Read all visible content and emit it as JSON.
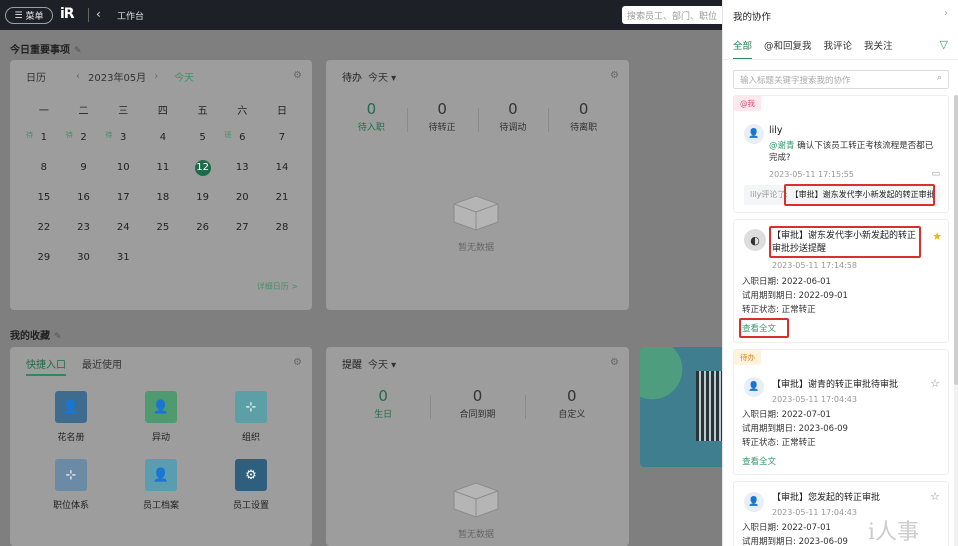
{
  "topbar": {
    "menu_label": "菜单",
    "logo_text": "iR",
    "breadcrumb": "工作台",
    "search_placeholder": "搜索员工、部门、职位"
  },
  "today": {
    "section_title": "今日重要事项",
    "calendar": {
      "title": "日历",
      "month": "2023年05月",
      "today_label": "今天",
      "weekdays": [
        "一",
        "二",
        "三",
        "四",
        "五",
        "六",
        "日"
      ],
      "weeks": [
        [
          {
            "d": "1",
            "m": "待"
          },
          {
            "d": "2",
            "m": "待"
          },
          {
            "d": "3",
            "m": "待"
          },
          {
            "d": "4",
            "m": ""
          },
          {
            "d": "5",
            "m": ""
          },
          {
            "d": "6",
            "m": "班"
          },
          {
            "d": "7",
            "m": ""
          }
        ],
        [
          {
            "d": "8",
            "m": ""
          },
          {
            "d": "9",
            "m": ""
          },
          {
            "d": "10",
            "m": ""
          },
          {
            "d": "11",
            "m": ""
          },
          {
            "d": "12",
            "m": "",
            "today": true
          },
          {
            "d": "13",
            "m": ""
          },
          {
            "d": "14",
            "m": ""
          }
        ],
        [
          {
            "d": "15",
            "m": ""
          },
          {
            "d": "16",
            "m": ""
          },
          {
            "d": "17",
            "m": ""
          },
          {
            "d": "18",
            "m": ""
          },
          {
            "d": "19",
            "m": ""
          },
          {
            "d": "20",
            "m": ""
          },
          {
            "d": "21",
            "m": ""
          }
        ],
        [
          {
            "d": "22",
            "m": ""
          },
          {
            "d": "23",
            "m": ""
          },
          {
            "d": "24",
            "m": ""
          },
          {
            "d": "25",
            "m": ""
          },
          {
            "d": "26",
            "m": ""
          },
          {
            "d": "27",
            "m": ""
          },
          {
            "d": "28",
            "m": ""
          }
        ],
        [
          {
            "d": "29",
            "m": ""
          },
          {
            "d": "30",
            "m": ""
          },
          {
            "d": "31",
            "m": ""
          },
          {
            "d": "",
            "m": ""
          },
          {
            "d": "",
            "m": ""
          },
          {
            "d": "",
            "m": ""
          },
          {
            "d": "",
            "m": ""
          }
        ]
      ],
      "detail_link": "详细日历 >"
    },
    "todo": {
      "title": "待办",
      "filter": "今天",
      "stats": [
        {
          "num": "0",
          "label": "待入职"
        },
        {
          "num": "0",
          "label": "待转正"
        },
        {
          "num": "0",
          "label": "待调动"
        },
        {
          "num": "0",
          "label": "待离职"
        }
      ],
      "empty_text": "暂无数据"
    }
  },
  "favorites": {
    "section_title": "我的收藏",
    "tabs": [
      "快捷入口",
      "最近使用"
    ],
    "shortcuts": [
      {
        "label": "花名册",
        "color": "#3e6c8f"
      },
      {
        "label": "异动",
        "color": "#4f9a6e"
      },
      {
        "label": "组织",
        "color": "#5c9fa6"
      },
      {
        "label": "职位体系",
        "color": "#6b8aa6"
      },
      {
        "label": "员工档案",
        "color": "#5a9cb0"
      },
      {
        "label": "员工设置",
        "color": "#2f5f7e"
      }
    ]
  },
  "reminders": {
    "title": "提醒",
    "filter": "今天",
    "stats": [
      {
        "num": "0",
        "label": "生日"
      },
      {
        "num": "0",
        "label": "合同到期"
      },
      {
        "num": "0",
        "label": "自定义"
      }
    ],
    "empty_text": "暂无数据"
  },
  "panel": {
    "title": "我的协作",
    "tabs": [
      "全部",
      "@和回复我",
      "我评论",
      "我关注"
    ],
    "search_placeholder": "输入标题关键字搜索我的协作",
    "cards": [
      {
        "tag": "@我",
        "author": "lily",
        "mention": "@谢青",
        "content": "确认下该员工转正考核流程是否都已完成?",
        "time": "2023-05-11 17:15:55",
        "comment_prefix": "lily评论了:",
        "comment_subject": "【审批】谢东发代李小新发起的转正审批"
      },
      {
        "title": "【审批】谢东发代李小新发起的转正审批抄送提醒",
        "time": "2023-05-11 17:14:58",
        "lines": [
          "入职日期: 2022-06-01",
          "试用期到期日: 2022-09-01",
          "转正状态: 正常转正"
        ],
        "link": "查看全文",
        "starred": true
      },
      {
        "tag": "待办",
        "title": "【审批】谢青的转正审批待审批",
        "time": "2023-05-11 17:04:43",
        "lines": [
          "入职日期: 2022-07-01",
          "试用期到期日: 2023-06-09",
          "转正状态: 正常转正"
        ],
        "link": "查看全文",
        "starred": false
      },
      {
        "title": "【审批】您发起的转正审批",
        "time": "2023-05-11 17:04:43",
        "lines": [
          "入职日期: 2022-07-01",
          "试用期到期日: 2023-06-09"
        ],
        "starred": false
      }
    ]
  },
  "watermark": "i人事",
  "colors": {
    "accent": "#2e9b6a",
    "highlight": "#d9302e",
    "overlay": "#7f7f80"
  }
}
